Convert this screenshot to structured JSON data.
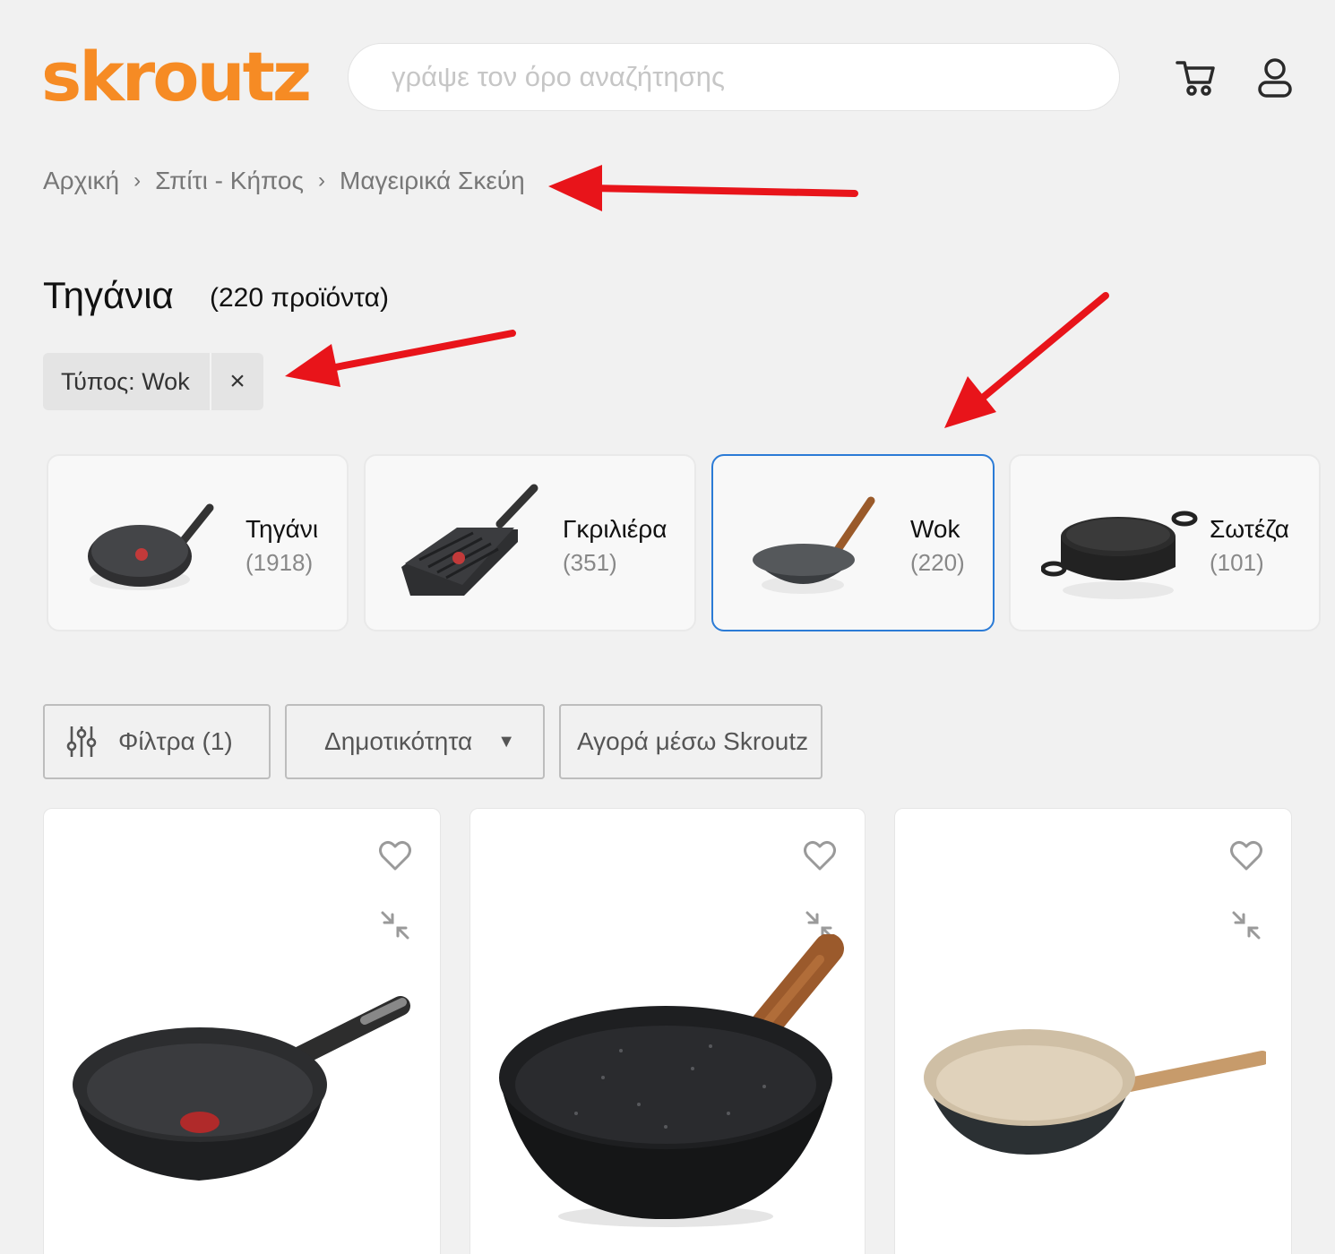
{
  "header": {
    "logo_text": "skroutz",
    "search_placeholder": "γράψε τον όρο αναζήτησης",
    "brand_color": "#f68b24"
  },
  "breadcrumb": {
    "items": [
      "Αρχική",
      "Σπίτι - Κήπος",
      "Μαγειρικά Σκεύη"
    ]
  },
  "page": {
    "title": "Τηγάνια",
    "count": "(220 προϊόντα)"
  },
  "active_filter": {
    "label": "Τύπος: Wok",
    "close": "×"
  },
  "categories": [
    {
      "name": "Τηγάνι",
      "count": "(1918)"
    },
    {
      "name": "Γκριλιέρα",
      "count": "(351)"
    },
    {
      "name": "Wok",
      "count": "(220)",
      "selected": true
    },
    {
      "name": "Σωτέζα",
      "count": "(101)"
    }
  ],
  "toolbar": {
    "filters_label": "Φίλτρα (1)",
    "sort_label": "Δημοτικότητα",
    "skroutz_buy_label": "Αγορά μέσω Skroutz"
  },
  "colors": {
    "selected_border": "#2b7bd6",
    "annotation_arrow": "#e8141a"
  },
  "products": [
    {
      "icon": "heart-icon"
    },
    {
      "icon": "heart-icon"
    },
    {
      "icon": "heart-icon"
    }
  ]
}
